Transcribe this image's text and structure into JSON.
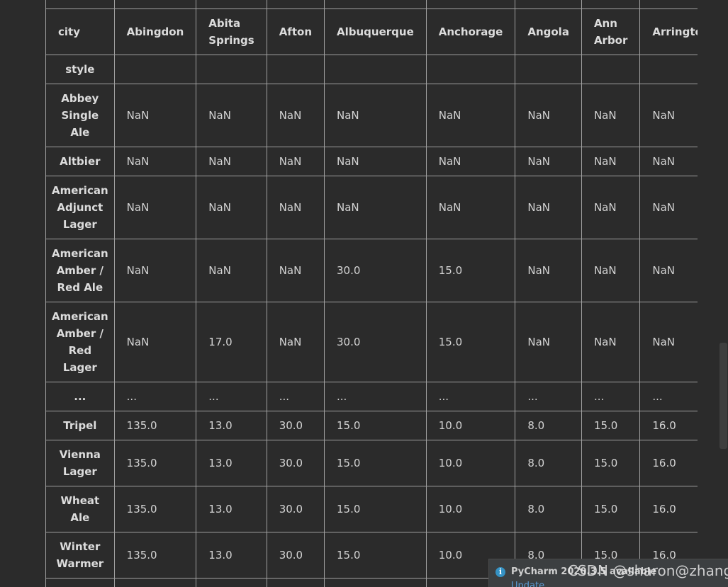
{
  "table": {
    "index_header": "city",
    "index_name": "style",
    "columns": [
      "Abingdon",
      "Abita Springs",
      "Afton",
      "Albuquerque",
      "Anchorage",
      "Angola",
      "Ann Arbor",
      "Arrington"
    ],
    "rows": [
      {
        "label": "Abbey Single Ale",
        "values": [
          "NaN",
          "NaN",
          "NaN",
          "NaN",
          "NaN",
          "NaN",
          "NaN",
          "NaN"
        ]
      },
      {
        "label": "Altbier",
        "values": [
          "NaN",
          "NaN",
          "NaN",
          "NaN",
          "NaN",
          "NaN",
          "NaN",
          "NaN"
        ]
      },
      {
        "label": "American Adjunct Lager",
        "values": [
          "NaN",
          "NaN",
          "NaN",
          "NaN",
          "NaN",
          "NaN",
          "NaN",
          "NaN"
        ]
      },
      {
        "label": "American Amber / Red Ale",
        "values": [
          "NaN",
          "NaN",
          "NaN",
          "30.0",
          "15.0",
          "NaN",
          "NaN",
          "NaN"
        ]
      },
      {
        "label": "American Amber / Red Lager",
        "values": [
          "NaN",
          "17.0",
          "NaN",
          "30.0",
          "15.0",
          "NaN",
          "NaN",
          "NaN"
        ]
      },
      {
        "label": "...",
        "values": [
          "...",
          "...",
          "...",
          "...",
          "...",
          "...",
          "...",
          "..."
        ]
      },
      {
        "label": "Tripel",
        "values": [
          "135.0",
          "13.0",
          "30.0",
          "15.0",
          "10.0",
          "8.0",
          "15.0",
          "16.0"
        ]
      },
      {
        "label": "Vienna Lager",
        "values": [
          "135.0",
          "13.0",
          "30.0",
          "15.0",
          "10.0",
          "8.0",
          "15.0",
          "16.0"
        ]
      },
      {
        "label": "Wheat Ale",
        "values": [
          "135.0",
          "13.0",
          "30.0",
          "15.0",
          "10.0",
          "8.0",
          "15.0",
          "16.0"
        ]
      },
      {
        "label": "Winter Warmer",
        "values": [
          "135.0",
          "13.0",
          "30.0",
          "15.0",
          "10.0",
          "8.0",
          "15.0",
          "16.0"
        ]
      }
    ]
  },
  "notification": {
    "icon": "info-icon",
    "message": "PyCharm 2020.3.5 available",
    "link": "Update..."
  },
  "watermark": "CSDN @sharon@zhang"
}
